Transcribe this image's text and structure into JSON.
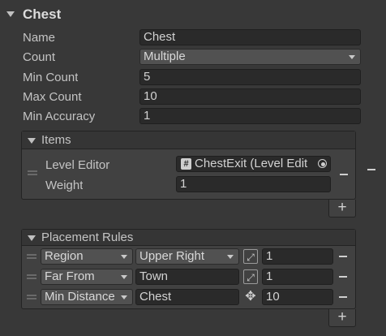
{
  "component": {
    "title": "Chest"
  },
  "fields": {
    "name_label": "Name",
    "name_value": "Chest",
    "count_label": "Count",
    "count_value": "Multiple",
    "min_count_label": "Min Count",
    "min_count_value": "5",
    "max_count_label": "Max Count",
    "max_count_value": "10",
    "min_accuracy_label": "Min Accuracy",
    "min_accuracy_value": "1"
  },
  "items": {
    "title": "Items",
    "level_editor_label": "Level Editor",
    "level_editor_value": "ChestExit (Level Edit",
    "weight_label": "Weight",
    "weight_value": "1"
  },
  "placement_rules": {
    "title": "Placement Rules",
    "rows": [
      {
        "type": "Region",
        "target": "Upper Right",
        "target_kind": "dropdown",
        "icon": "expand-icon",
        "value": "1"
      },
      {
        "type": "Far From",
        "target": "Town",
        "target_kind": "field",
        "icon": "expand-icon",
        "value": "1"
      },
      {
        "type": "Min Distance",
        "target": "Chest",
        "target_kind": "field",
        "icon": "move-icon",
        "value": "10"
      }
    ]
  },
  "buttons": {
    "plus": "+",
    "minus": "−"
  },
  "icons": {
    "script_glyph": "#",
    "expand_glyph": "⤢",
    "move_glyph": "✥"
  }
}
